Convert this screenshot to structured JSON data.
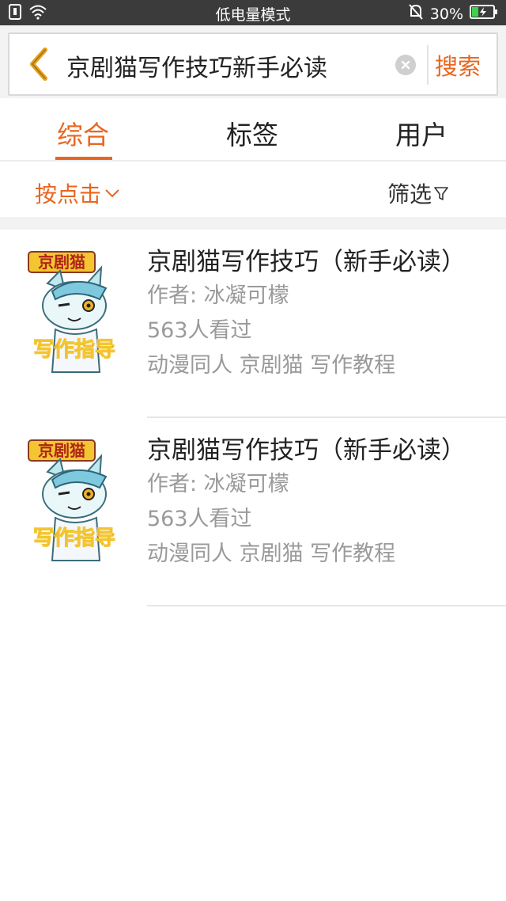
{
  "status_bar": {
    "center_text": "低电量模式",
    "battery_percent": "30%",
    "battery_level": 0.3
  },
  "search": {
    "back_icon": "chevron-left-icon",
    "query": "京剧猫写作技巧新手必读",
    "clear_icon": "clear-icon",
    "search_label": "搜索"
  },
  "tabs": [
    {
      "label": "综合",
      "active": true
    },
    {
      "label": "标签",
      "active": false
    },
    {
      "label": "用户",
      "active": false
    }
  ],
  "filters": {
    "sort_label": "按点击",
    "filter_label": "筛选"
  },
  "results": [
    {
      "title": "京剧猫写作技巧（新手必读）",
      "author": "作者: 冰凝可檬",
      "views": "563人看过",
      "tags": "动漫同人 京剧猫 写作教程",
      "cover_text_top": "京剧猫",
      "cover_text_bottom": "写作指导"
    },
    {
      "title": "京剧猫写作技巧（新手必读）",
      "author": "作者: 冰凝可檬",
      "views": "563人看过",
      "tags": "动漫同人 京剧猫 写作教程",
      "cover_text_top": "京剧猫",
      "cover_text_bottom": "写作指导"
    }
  ],
  "colors": {
    "accent": "#e8661f",
    "status_bar_bg": "#3b3b3b",
    "secondary_text": "#9a9a9a"
  }
}
